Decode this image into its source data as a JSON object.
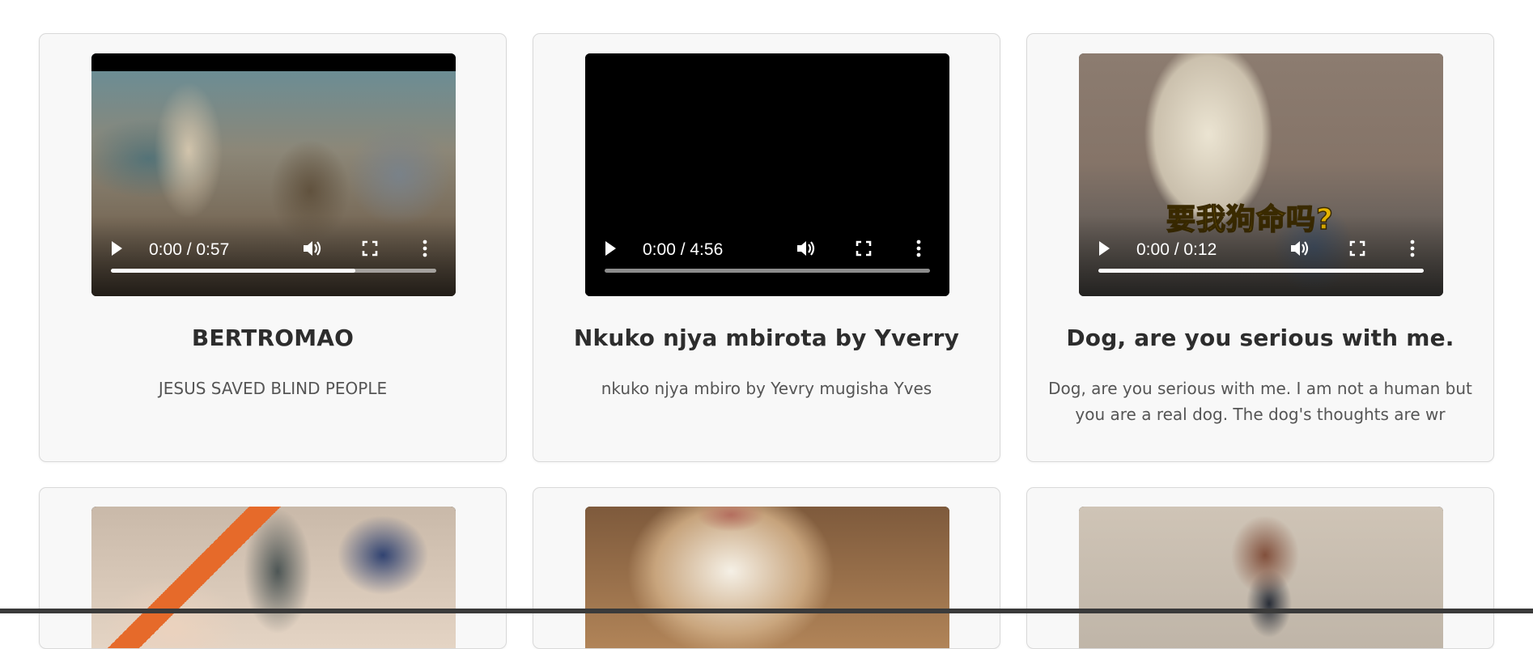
{
  "cards": [
    {
      "title": "BERTROMAO",
      "description": "JESUS SAVED BLIND PEOPLE",
      "video": {
        "time": "0:00 / 0:57",
        "progress": 0.75,
        "caption": ""
      }
    },
    {
      "title": "Nkuko njya mbirota by Yverry",
      "description": "nkuko njya mbiro by Yevry mugisha Yves",
      "video": {
        "time": "0:00 / 4:56",
        "progress": 0.0,
        "caption": ""
      }
    },
    {
      "title": "Dog, are you serious with me.",
      "description": "Dog, are you serious with me. I am not a human but you are a real dog. The dog's thoughts are wr",
      "video": {
        "time": "0:00 / 0:12",
        "progress": 1.0,
        "caption": "要我狗命吗?"
      }
    }
  ],
  "row2_cards": [
    {
      "thumbnail": "bird"
    },
    {
      "thumbnail": "cat"
    },
    {
      "thumbnail": "bike"
    }
  ],
  "icons": {
    "play": "play-icon",
    "volume": "volume-icon",
    "fullscreen": "fullscreen-icon",
    "more": "more-vertical-icon"
  },
  "colors": {
    "card_bg": "#f8f8f8",
    "card_border": "#d9d9d9",
    "title": "#2d2d2d",
    "description": "#555555",
    "video_bg": "#000000"
  }
}
